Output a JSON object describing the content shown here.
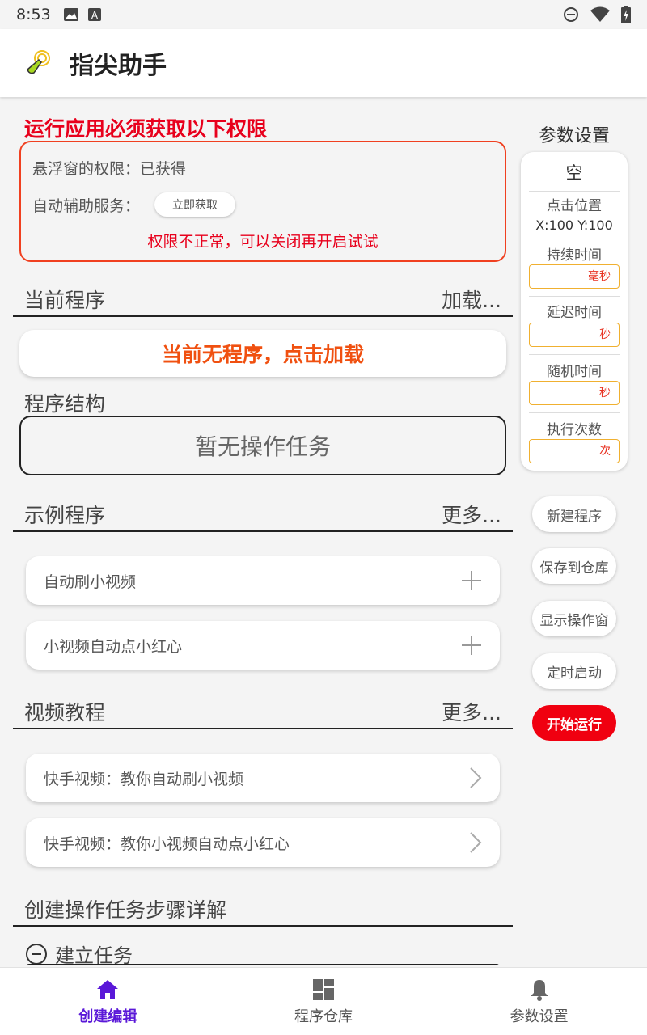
{
  "status_bar": {
    "time": "8:53"
  },
  "app_bar": {
    "title": "指尖助手"
  },
  "permissions": {
    "title": "运行应用必须获取以下权限",
    "float_window": "悬浮窗的权限：已获得",
    "accessibility_label": "自动辅助服务：",
    "get_button": "立即获取",
    "warning": "权限不正常，可以关闭再开启试试"
  },
  "current_program": {
    "label": "当前程序",
    "more": "加载...",
    "card": "当前无程序，点击加载"
  },
  "structure": {
    "label": "程序结构",
    "empty": "暂无操作任务"
  },
  "examples": {
    "label": "示例程序",
    "more": "更多...",
    "items": [
      "自动刷小视频",
      "小视频自动点小红心"
    ]
  },
  "tutorials": {
    "label": "视频教程",
    "more": "更多...",
    "items": [
      "快手视频：教你自动刷小视频",
      "快手视频：教你小视频自动点小红心"
    ]
  },
  "steps": {
    "label": "创建操作任务步骤详解",
    "first": "建立任务"
  },
  "params": {
    "title": "参数设置",
    "name": "空",
    "click_pos_label": "点击位置",
    "click_pos": "X:100  Y:100",
    "duration_label": "持续时间",
    "duration_unit": "毫秒",
    "delay_label": "延迟时间",
    "delay_unit": "秒",
    "random_label": "随机时间",
    "random_unit": "秒",
    "count_label": "执行次数",
    "count_unit": "次"
  },
  "side_buttons": {
    "new": "新建程序",
    "save": "保存到仓库",
    "show": "显示操作窗",
    "timer": "定时启动",
    "run": "开始运行"
  },
  "bottom_nav": {
    "items": [
      "创建编辑",
      "程序仓库",
      "参数设置"
    ]
  },
  "colors": {
    "accent": "#5a18d8",
    "warning": "#e8001c",
    "load": "#f05010",
    "run": "#f00010"
  }
}
